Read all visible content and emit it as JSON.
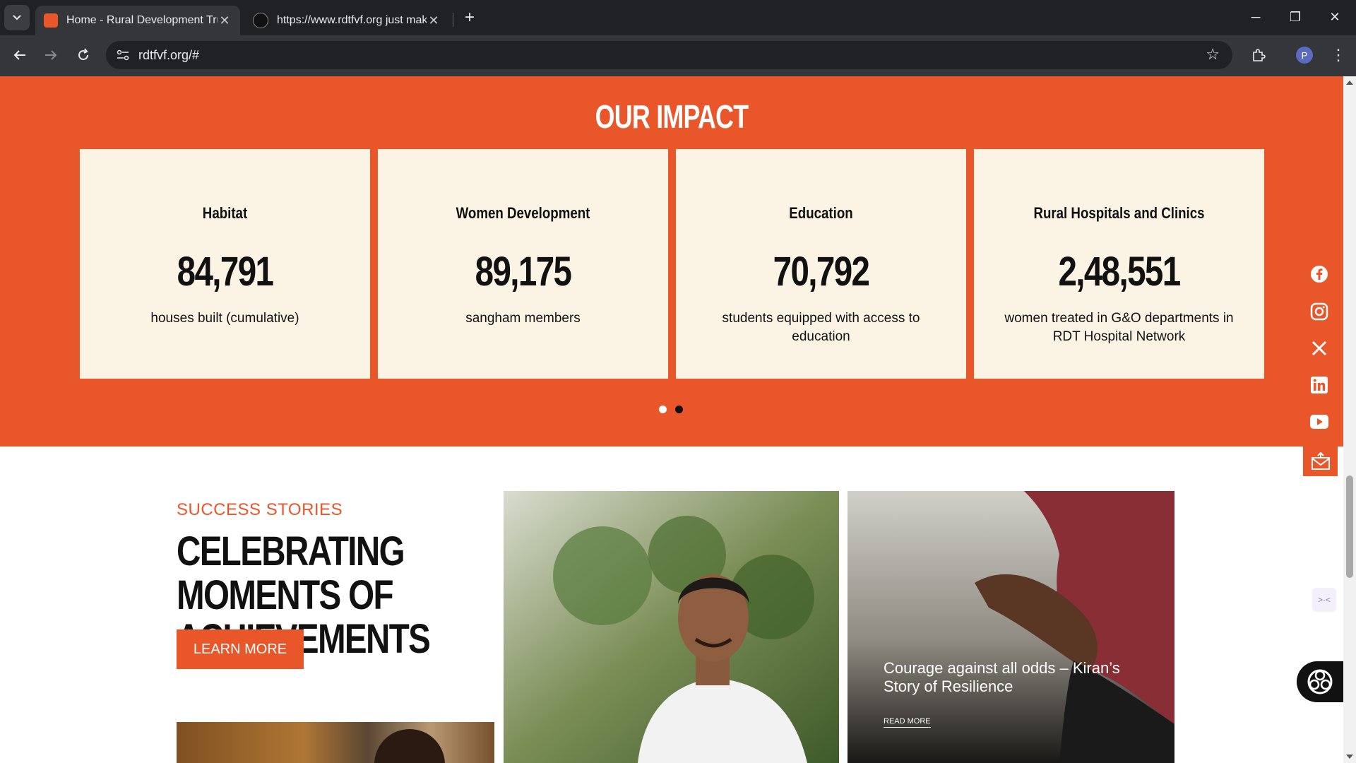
{
  "browser": {
    "tabs": [
      {
        "title": "Home - Rural Development Tru",
        "active": true
      },
      {
        "title": "https://www.rdtfvf.org just mak",
        "active": false
      }
    ],
    "url": "rdtfvf.org/#",
    "profile_initial": "P"
  },
  "impact": {
    "title": "OUR IMPACT",
    "cards": [
      {
        "title": "Habitat",
        "number": "84,791",
        "desc": "houses built (cumulative)"
      },
      {
        "title": "Women Development",
        "number": "89,175",
        "desc": "sangham members"
      },
      {
        "title": "Education",
        "number": "70,792",
        "desc": "students equipped with access to education"
      },
      {
        "title": "Rural Hospitals and Clinics",
        "number": "2,48,551",
        "desc": "women treated in G&O departments in RDT Hospital Network"
      }
    ],
    "active_slide": 2
  },
  "social": [
    "facebook-icon",
    "instagram-icon",
    "x-icon",
    "linkedin-icon",
    "youtube-icon",
    "mail-icon"
  ],
  "stories": {
    "label": "SUCCESS STORIES",
    "heading": "CELEBRATING MOMENTS OF ACHIEVEMENTS",
    "learn_more": "LEARN MORE",
    "featured_title": "Courage against all odds – Kiran’s Story of Resilience",
    "read_more": "READ MORE"
  },
  "colors": {
    "brand": "#e8562a",
    "card": "#fbf4e4"
  }
}
